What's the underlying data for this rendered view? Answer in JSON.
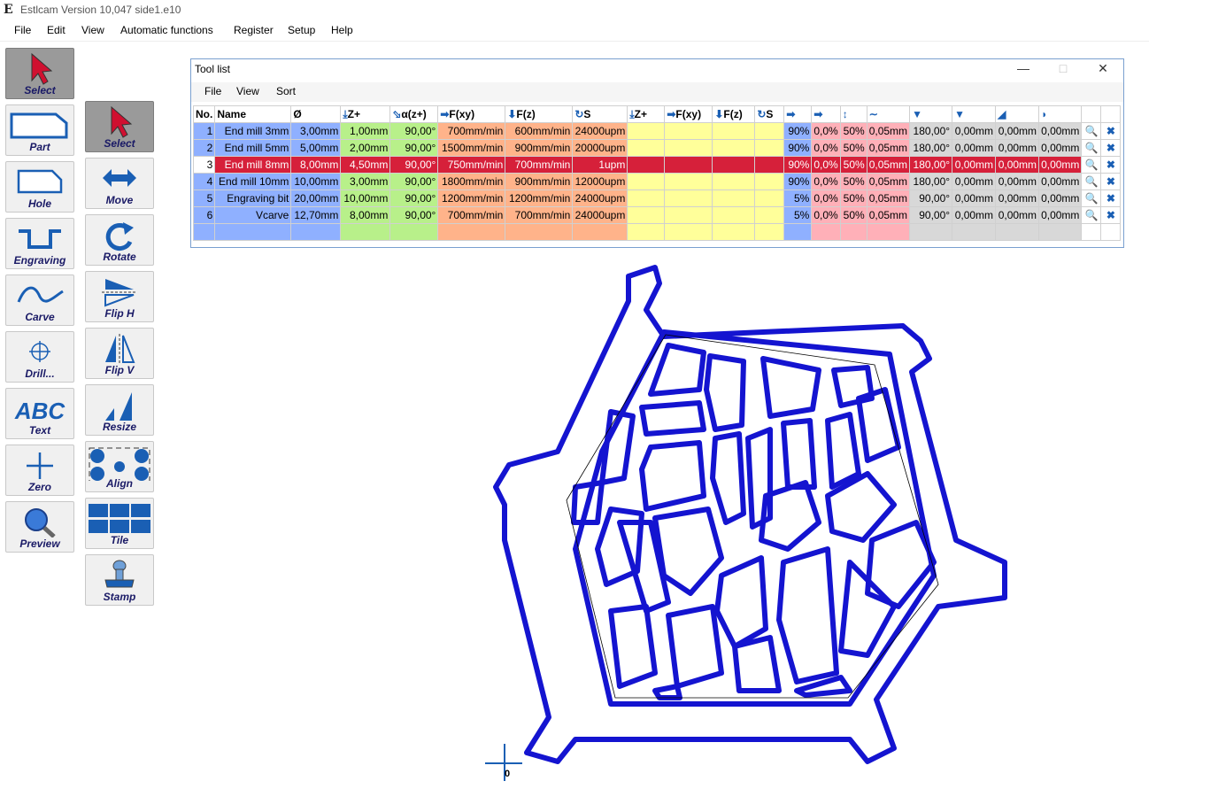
{
  "app": {
    "title": "Estlcam Version 10,047 side1.e10"
  },
  "menu": [
    "File",
    "Edit",
    "View",
    "Automatic functions",
    "Register",
    "Setup",
    "Help"
  ],
  "left_tools": [
    {
      "id": "select",
      "label": "Select"
    },
    {
      "id": "part",
      "label": "Part"
    },
    {
      "id": "hole",
      "label": "Hole"
    },
    {
      "id": "engraving",
      "label": "Engraving"
    },
    {
      "id": "carve",
      "label": "Carve"
    },
    {
      "id": "drill",
      "label": "Drill..."
    },
    {
      "id": "text",
      "label": "Text"
    },
    {
      "id": "zero",
      "label": "Zero"
    },
    {
      "id": "preview",
      "label": "Preview"
    }
  ],
  "right_tools": [
    {
      "id": "select",
      "label": "Select"
    },
    {
      "id": "move",
      "label": "Move"
    },
    {
      "id": "rotate",
      "label": "Rotate"
    },
    {
      "id": "fliph",
      "label": "Flip H"
    },
    {
      "id": "flipv",
      "label": "Flip V"
    },
    {
      "id": "resize",
      "label": "Resize"
    },
    {
      "id": "align",
      "label": "Align"
    },
    {
      "id": "tile",
      "label": "Tile"
    },
    {
      "id": "stamp",
      "label": "Stamp"
    }
  ],
  "toolwin": {
    "title": "Tool list",
    "menu": [
      "File",
      "View",
      "Sort"
    ],
    "headers": [
      "No.",
      "Name",
      "Ø",
      "Z+",
      "α(z+)",
      "F(xy)",
      "F(z)",
      "S",
      "Z+",
      "F(xy)",
      "F(z)",
      "S"
    ],
    "rows": [
      {
        "no": "1",
        "name": "End mill 3mm",
        "dia": "3,00mm",
        "z": "1,00mm",
        "ang": "90,00°",
        "fxy": "700mm/min",
        "fz": "600mm/min",
        "s": "24000upm",
        "p1": "90%",
        "p2": "0,0%",
        "p3": "50%",
        "p4": "0,05mm",
        "g1": "180,00°",
        "g2": "0,00mm",
        "g3": "0,00mm",
        "g4": "0,00mm"
      },
      {
        "no": "2",
        "name": "End mill 5mm",
        "dia": "5,00mm",
        "z": "2,00mm",
        "ang": "90,00°",
        "fxy": "1500mm/min",
        "fz": "900mm/min",
        "s": "20000upm",
        "p1": "90%",
        "p2": "0,0%",
        "p3": "50%",
        "p4": "0,05mm",
        "g1": "180,00°",
        "g2": "0,00mm",
        "g3": "0,00mm",
        "g4": "0,00mm"
      },
      {
        "no": "3",
        "name": "End mill 8mm",
        "dia": "8,00mm",
        "z": "4,50mm",
        "ang": "90,00°",
        "fxy": "750mm/min",
        "fz": "700mm/min",
        "s": "1upm",
        "p1": "90%",
        "p2": "0,0%",
        "p3": "50%",
        "p4": "0,05mm",
        "g1": "180,00°",
        "g2": "0,00mm",
        "g3": "0,00mm",
        "g4": "0,00mm"
      },
      {
        "no": "4",
        "name": "End mill 10mm",
        "dia": "10,00mm",
        "z": "3,00mm",
        "ang": "90,00°",
        "fxy": "1800mm/min",
        "fz": "900mm/min",
        "s": "12000upm",
        "p1": "90%",
        "p2": "0,0%",
        "p3": "50%",
        "p4": "0,05mm",
        "g1": "180,00°",
        "g2": "0,00mm",
        "g3": "0,00mm",
        "g4": "0,00mm"
      },
      {
        "no": "5",
        "name": "Engraving bit",
        "dia": "20,00mm",
        "z": "10,00mm",
        "ang": "90,00°",
        "fxy": "1200mm/min",
        "fz": "1200mm/min",
        "s": "24000upm",
        "p1": "5%",
        "p2": "0,0%",
        "p3": "50%",
        "p4": "0,05mm",
        "g1": "90,00°",
        "g2": "0,00mm",
        "g3": "0,00mm",
        "g4": "0,00mm"
      },
      {
        "no": "6",
        "name": "Vcarve",
        "dia": "12,70mm",
        "z": "8,00mm",
        "ang": "90,00°",
        "fxy": "700mm/min",
        "fz": "700mm/min",
        "s": "24000upm",
        "p1": "5%",
        "p2": "0,0%",
        "p3": "50%",
        "p4": "0,05mm",
        "g1": "90,00°",
        "g2": "0,00mm",
        "g3": "0,00mm",
        "g4": "0,00mm"
      }
    ]
  },
  "canvas": {
    "origin_label": "0",
    "path_color": "#1414d0"
  }
}
